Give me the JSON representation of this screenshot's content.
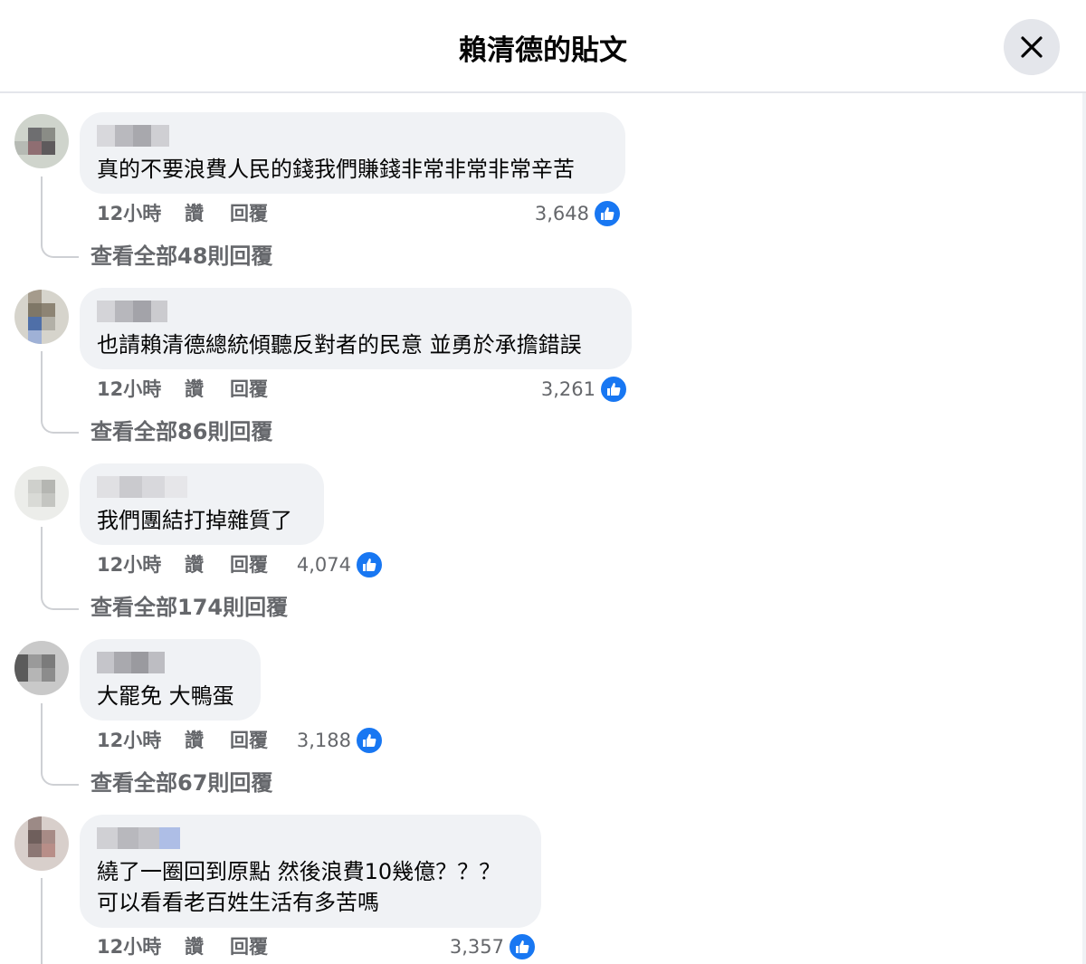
{
  "header": {
    "title": "賴清德的貼文",
    "close_icon": "close-icon"
  },
  "action_labels": {
    "like": "讚",
    "reply": "回覆"
  },
  "comments": [
    {
      "text": "真的不要浪費人民的錢我們賺錢非常非常非常辛苦",
      "time": "12小時",
      "like_count": "3,648",
      "view_replies": "查看全部48則回覆"
    },
    {
      "text": "也請賴清德總統傾聽反對者的民意 並勇於承擔錯誤",
      "time": "12小時",
      "like_count": "3,261",
      "view_replies": "查看全部86則回覆"
    },
    {
      "text": "我們團結打掉雜質了",
      "time": "12小時",
      "like_count": "4,074",
      "view_replies": "查看全部174則回覆"
    },
    {
      "text": "大罷免 大鴨蛋",
      "time": "12小時",
      "like_count": "3,188",
      "view_replies": "查看全部67則回覆"
    },
    {
      "text": "繞了一圈回到原點 然後浪費10幾億？？？\n可以看看老百姓生活有多苦嗎",
      "time": "12小時",
      "like_count": "3,357",
      "view_replies": ""
    }
  ],
  "colors": {
    "bubble": "#f0f2f5",
    "like_badge": "#1877f2",
    "meta_text": "#65676b"
  }
}
